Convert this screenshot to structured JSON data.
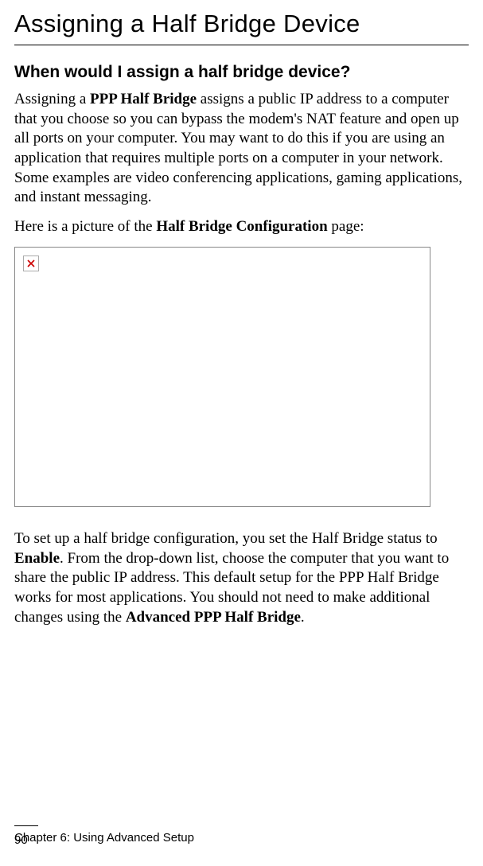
{
  "title": "Assigning a Half Bridge Device",
  "section_heading": "When would I assign a half bridge device?",
  "para1_pre": "Assigning a ",
  "para1_bold1": "PPP Half Bridge",
  "para1_post": " assigns a public IP address to a computer that you choose so you can bypass the modem's NAT feature and open up all ports on your computer. You may want to do this if you are using an application that requires multiple ports on a computer in your network. Some examples are video conferencing applications, gaming applications, and instant messaging.",
  "para2_pre": "Here is a picture of the ",
  "para2_bold": "Half Bridge Configuration",
  "para2_post": " page:",
  "para3_pre": "To set up a half bridge configuration, you set the Half Bridge status to ",
  "para3_bold1": "Enable",
  "para3_mid": ". From the drop-down list, choose the computer that you want to share the public IP address. This default setup for the PPP Half Bridge works for most applications. You should not need to make additional changes using the ",
  "para3_bold2": "Advanced PPP Half Bridge",
  "para3_post": ".",
  "footer_chapter": "Chapter 6: Using Advanced Setup",
  "footer_page": "90"
}
